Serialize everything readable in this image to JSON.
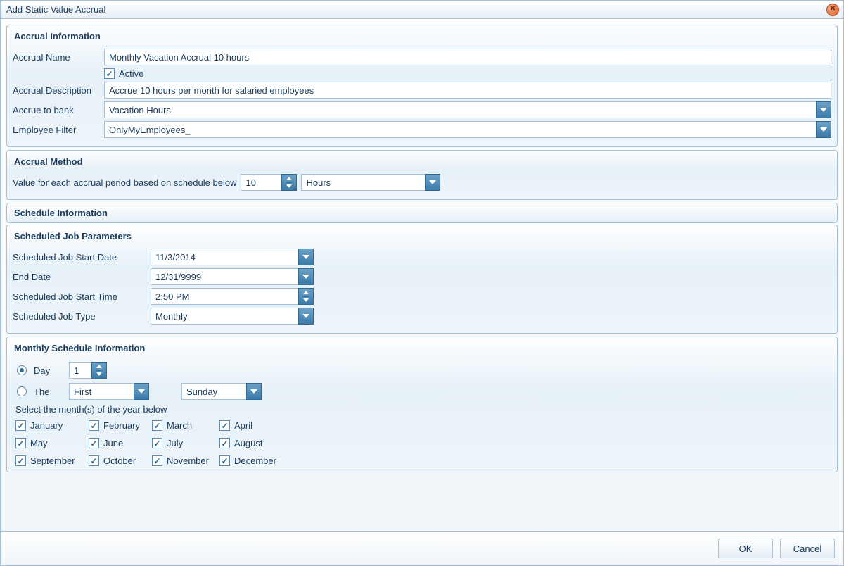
{
  "window": {
    "title": "Add Static Value Accrual"
  },
  "accrual_info": {
    "title": "Accrual Information",
    "name_label": "Accrual Name",
    "name_value": "Monthly Vacation Accrual 10 hours",
    "active_label": "Active",
    "active_checked": true,
    "description_label": "Accrual Description",
    "description_value": "Accrue 10 hours per month for salaried employees",
    "bank_label": "Accrue to bank",
    "bank_value": "Vacation Hours",
    "filter_label": "Employee Filter",
    "filter_value": "OnlyMyEmployees_"
  },
  "accrual_method": {
    "title": "Accrual Method",
    "value_label": "Value for each accrual period based on schedule below",
    "value_amount": "10",
    "unit_value": "Hours"
  },
  "schedule_info": {
    "title": "Schedule Information",
    "job_params": {
      "title": "Scheduled Job Parameters",
      "start_date_label": "Scheduled Job Start Date",
      "start_date_value": "11/3/2014",
      "end_date_label": "End Date",
      "end_date_value": "12/31/9999",
      "start_time_label": "Scheduled Job Start Time",
      "start_time_value": "2:50 PM",
      "job_type_label": "Scheduled Job Type",
      "job_type_value": "Monthly"
    },
    "monthly": {
      "title": "Monthly Schedule Information",
      "day_label": "Day",
      "day_value": "1",
      "day_selected": true,
      "the_label": "The",
      "the_selected": false,
      "ordinal_value": "First",
      "weekday_value": "Sunday",
      "select_months_label": "Select the month(s) of the year below",
      "months": [
        {
          "label": "January",
          "checked": true
        },
        {
          "label": "February",
          "checked": true
        },
        {
          "label": "March",
          "checked": true
        },
        {
          "label": "April",
          "checked": true
        },
        {
          "label": "May",
          "checked": true
        },
        {
          "label": "June",
          "checked": true
        },
        {
          "label": "July",
          "checked": true
        },
        {
          "label": "August",
          "checked": true
        },
        {
          "label": "September",
          "checked": true
        },
        {
          "label": "October",
          "checked": true
        },
        {
          "label": "November",
          "checked": true
        },
        {
          "label": "December",
          "checked": true
        }
      ]
    }
  },
  "footer": {
    "ok_label": "OK",
    "cancel_label": "Cancel"
  }
}
